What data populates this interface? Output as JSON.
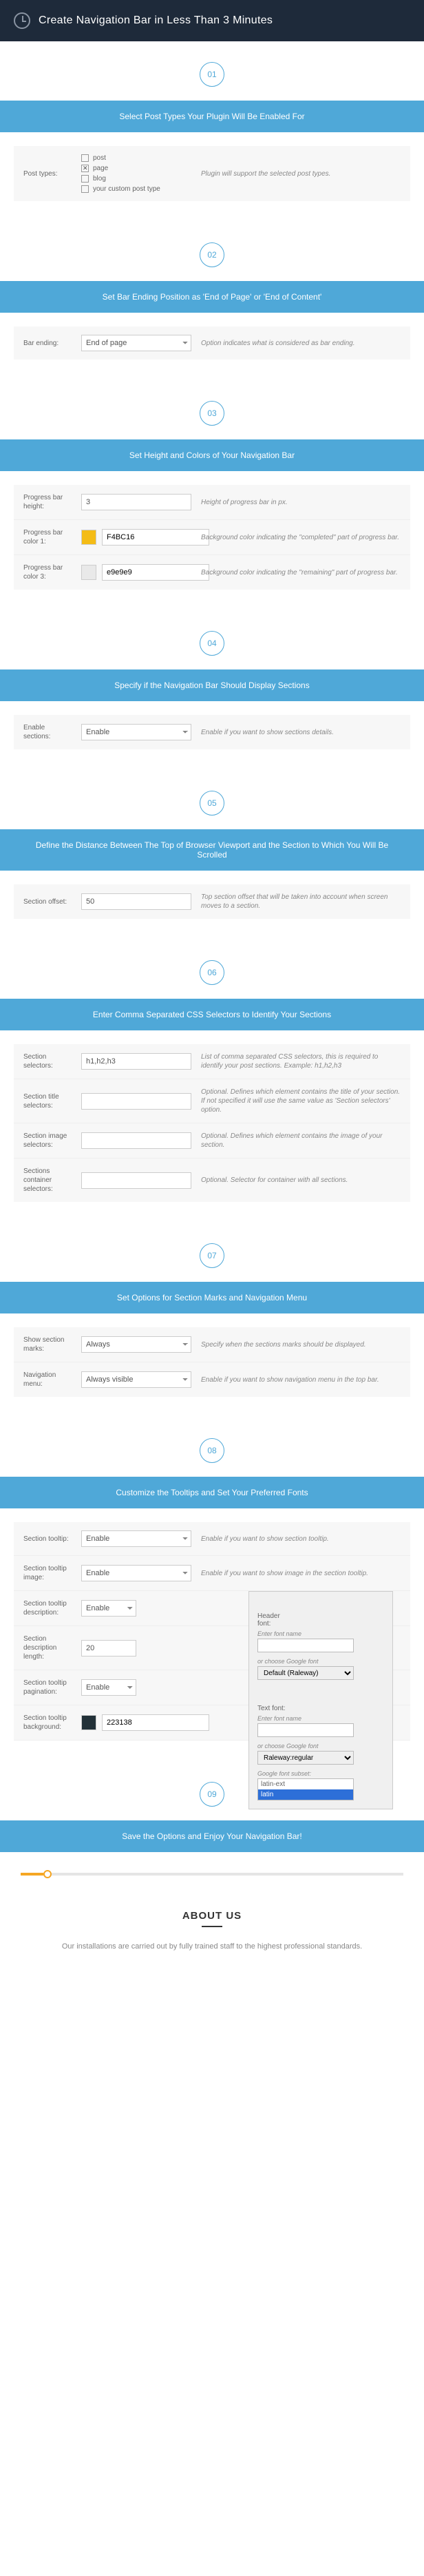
{
  "hero": {
    "title": "Create Navigation Bar in Less Than 3 Minutes"
  },
  "steps": [
    {
      "num": "01",
      "heading": "Select Post Types Your Plugin Will Be Enabled For"
    },
    {
      "num": "02",
      "heading": "Set Bar Ending Position as 'End of Page' or 'End of Content'"
    },
    {
      "num": "03",
      "heading": "Set Height and Colors of Your Navigation Bar"
    },
    {
      "num": "04",
      "heading": "Specify if the Navigation Bar Should Display Sections"
    },
    {
      "num": "05",
      "heading": "Define the Distance Between The Top of Browser Viewport and the Section to Which You Will Be Scrolled"
    },
    {
      "num": "06",
      "heading": "Enter Comma Separated CSS Selectors to Identify Your Sections"
    },
    {
      "num": "07",
      "heading": "Set Options for Section Marks and Navigation Menu"
    },
    {
      "num": "08",
      "heading": "Customize the Tooltips and Set Your Preferred Fonts"
    },
    {
      "num": "09",
      "heading": "Save the Options and Enjoy Your Navigation Bar!"
    }
  ],
  "s1": {
    "label": "Post types:",
    "options": [
      {
        "label": "post",
        "checked": false
      },
      {
        "label": "page",
        "checked": true
      },
      {
        "label": "blog",
        "checked": false
      },
      {
        "label": "your custom post type",
        "checked": false
      }
    ],
    "help": "Plugin will support the selected post types."
  },
  "s2": {
    "label": "Bar ending:",
    "value": "End of page",
    "help": "Option indicates what is considered as bar ending."
  },
  "s3": {
    "r1": {
      "label": "Progress bar height:",
      "value": "3",
      "help": "Height of progress bar in px."
    },
    "r2": {
      "label": "Progress bar color 1:",
      "value": "F4BC16",
      "swatch": "#F4BC16",
      "help": "Background color indicating the \"completed\" part of progress bar."
    },
    "r3": {
      "label": "Progress bar color 3:",
      "value": "e9e9e9",
      "swatch": "#e9e9e9",
      "help": "Background color indicating the \"remaining\" part of progress bar."
    }
  },
  "s4": {
    "label": "Enable sections:",
    "value": "Enable",
    "help": "Enable if you want to show sections details."
  },
  "s5": {
    "label": "Section offset:",
    "value": "50",
    "help": "Top section offset that will be taken into account when screen moves to a section."
  },
  "s6": {
    "r1": {
      "label": "Section selectors:",
      "value": "h1,h2,h3",
      "help": "List of comma separated CSS selectors, this is required to identify your post sections. Example: h1,h2,h3"
    },
    "r2": {
      "label": "Section title selectors:",
      "value": "",
      "help": "Optional. Defines which element contains the title of your section. If not specified it will use the same value as 'Section selectors' option."
    },
    "r3": {
      "label": "Section image selectors:",
      "value": "",
      "help": "Optional. Defines which element contains the image of your section."
    },
    "r4": {
      "label": "Sections container selectors:",
      "value": "",
      "help": "Optional. Selector for container with all sections."
    }
  },
  "s7": {
    "r1": {
      "label": "Show section marks:",
      "value": "Always",
      "help": "Specify when the sections marks should be displayed."
    },
    "r2": {
      "label": "Navigation menu:",
      "value": "Always visible",
      "help": "Enable if you want to show navigation menu in the top bar."
    }
  },
  "s8": {
    "r1": {
      "label": "Section tooltip:",
      "value": "Enable",
      "help": "Enable if you want to show section tooltip."
    },
    "r2": {
      "label": "Section tooltip image:",
      "value": "Enable",
      "help": "Enable if you want to show image in the section tooltip."
    },
    "r3": {
      "label": "Section tooltip description:",
      "value": "Enable"
    },
    "r4": {
      "label": "Section description length:",
      "value": "20"
    },
    "r5": {
      "label": "Section tooltip pagination:",
      "value": "Enable"
    },
    "r6": {
      "label": "Section tooltip background:",
      "value": "223138",
      "swatch": "#223138"
    }
  },
  "fontpop": {
    "header": {
      "label": "Header font:",
      "cap1": "Enter font name",
      "val1": "",
      "cap2": "or choose Google font",
      "val2": "Default (Raleway)"
    },
    "text": {
      "label": "Text font:",
      "cap1": "Enter font name",
      "val1": "",
      "cap2": "or choose Google font",
      "val2": "Raleway:regular",
      "cap3": "Google font subset:",
      "subsets": [
        "latin-ext",
        "latin"
      ],
      "selected": "latin"
    }
  },
  "about": {
    "title": "ABOUT US",
    "text": "Our installations are carried out by fully trained staff to the highest professional standards."
  }
}
